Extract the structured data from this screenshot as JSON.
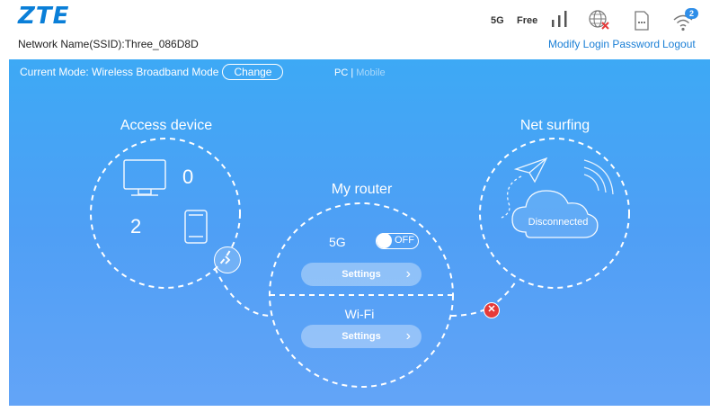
{
  "header": {
    "logo": "ZTE",
    "ssid_label": "Network Name(SSID):",
    "ssid_value": "Three_086D8D",
    "network_type": "5G",
    "provider": "Free",
    "wifi_clients_badge": "2",
    "modify_password_link": "Modify Login Password",
    "logout_link": "Logout",
    "icons": [
      "signal-strength-icon",
      "globe-disconnected-icon",
      "sim-card-icon",
      "wifi-icon"
    ]
  },
  "mode_bar": {
    "current_mode_text": "Current Mode: Wireless Broadband Mode",
    "change_button": "Change",
    "view_pc": "PC",
    "view_separator": "|",
    "view_mobile": "Mobile"
  },
  "access_device": {
    "title": "Access device",
    "wired_count": "0",
    "wireless_count": "2"
  },
  "my_router": {
    "title": "My router",
    "band_label": "5G",
    "toggle_state": "OFF",
    "settings_5g": "Settings",
    "wifi_label": "Wi-Fi",
    "settings_wifi": "Settings"
  },
  "net_surfing": {
    "title": "Net surfing",
    "status": "Disconnected"
  },
  "colors": {
    "brand": "#0a7fd8",
    "link": "#1a7fd6",
    "panel_top": "#3da9f5",
    "panel_bottom": "#63a4f7",
    "error": "#e53a3a"
  }
}
